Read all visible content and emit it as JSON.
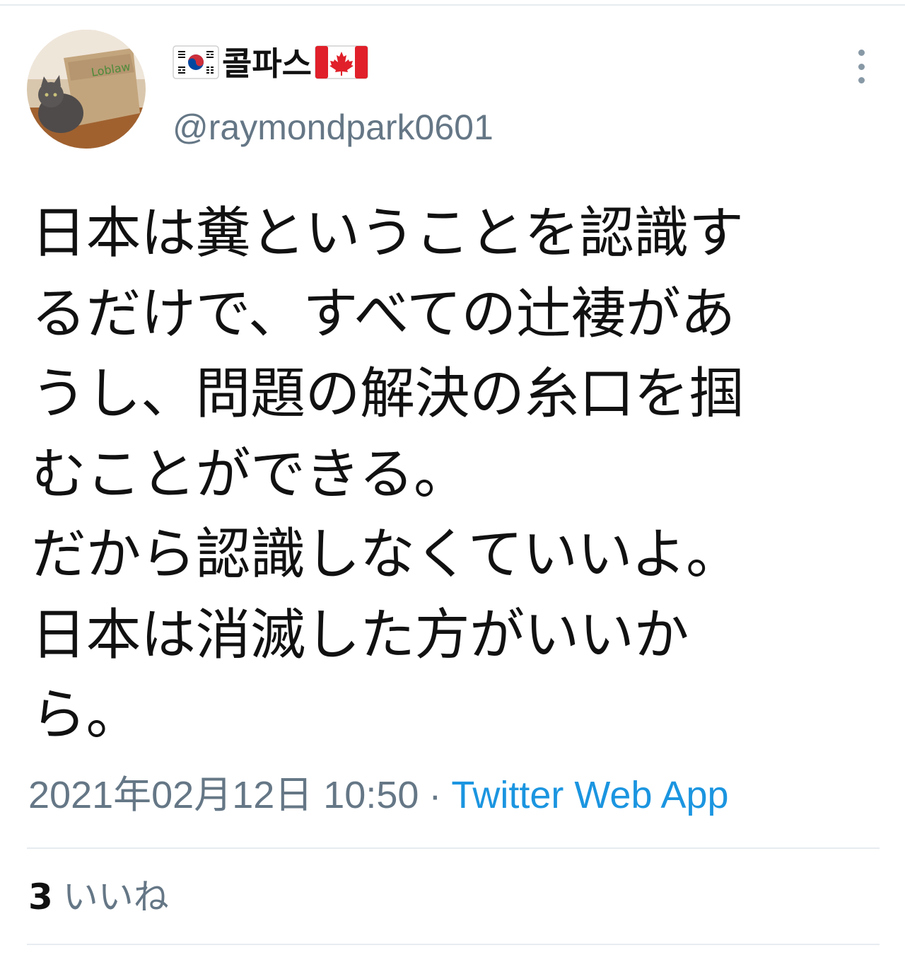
{
  "tweet": {
    "display_name": "콜파스",
    "name_emoji_before": "flag-south-korea",
    "name_emoji_after": "flag-canada",
    "handle": "@raymondpark0601",
    "text_lines": [
      "日本は糞ということを認識す",
      "るだけで、すべての辻褄があ",
      "うし、問題の解決の糸口を掴",
      "むことができる。",
      "だから認識しなくていいよ。",
      "日本は消滅した方がいいか",
      "ら。"
    ],
    "timestamp": "2021年02月12日 10:50",
    "separator": "·",
    "source": "Twitter Web App",
    "likes": {
      "count": "3",
      "label": "いいね"
    }
  },
  "colors": {
    "text": "#111111",
    "secondary": "#657786",
    "link": "#1b95e0",
    "divider": "#e6ecf0"
  },
  "icons": {
    "more": "more-vertical-icon"
  }
}
